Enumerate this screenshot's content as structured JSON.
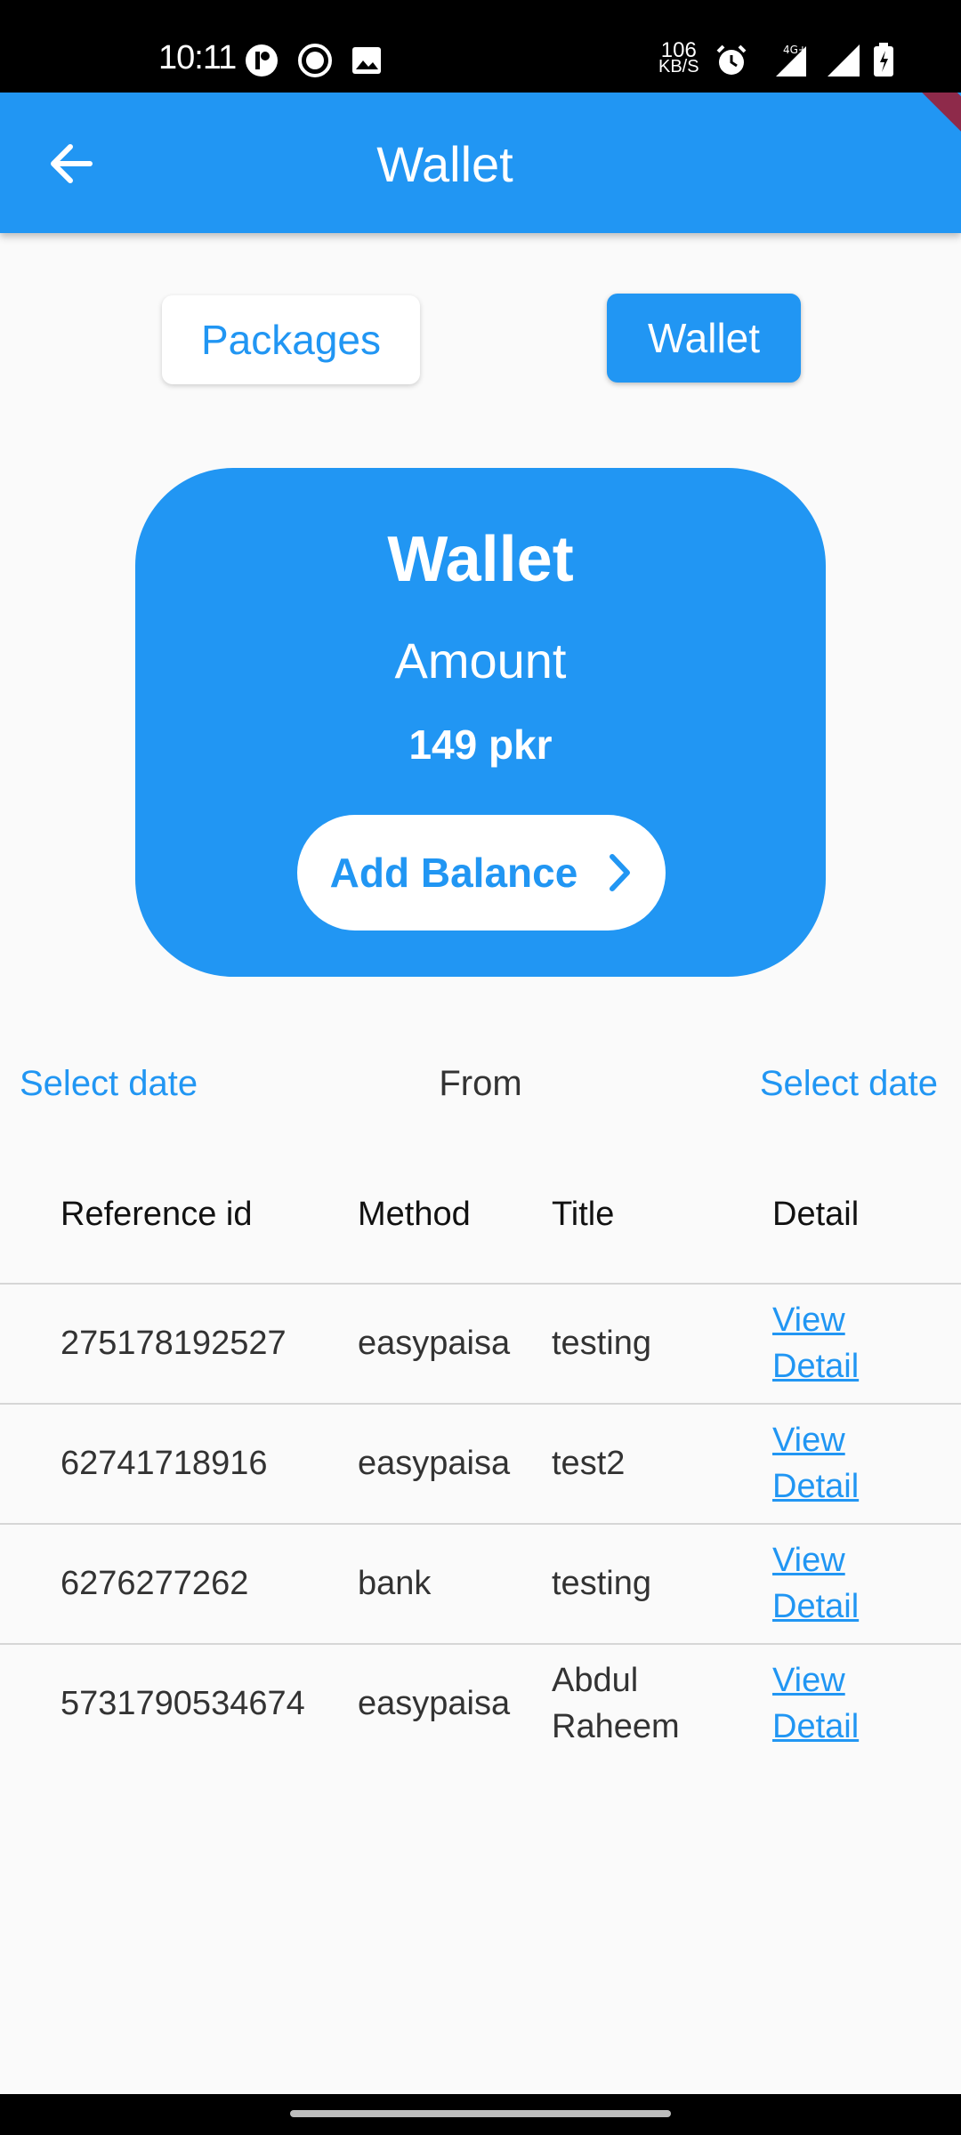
{
  "status_bar": {
    "time": "10:11",
    "speed_value": "106",
    "speed_unit": "KB/S",
    "network": "4G+",
    "icons": [
      "notification-icon",
      "record-icon",
      "image-icon",
      "alarm-icon",
      "signal-icon",
      "signal-icon",
      "battery-icon"
    ]
  },
  "app_bar": {
    "title": "Wallet",
    "back_icon": "arrow-back-icon"
  },
  "toggle": {
    "packages_label": "Packages",
    "wallet_label": "Wallet"
  },
  "wallet_card": {
    "title": "Wallet",
    "subtitle": "Amount",
    "amount": "149 pkr",
    "add_balance_label": "Add Balance"
  },
  "date_filter": {
    "start_label": "Select date",
    "from_label": "From",
    "end_label": "Select date"
  },
  "table": {
    "headers": [
      "Reference id",
      "Method",
      "Title",
      "Detail"
    ],
    "rows": [
      {
        "ref": "275178192527",
        "method": "easypaisa",
        "title": "testing",
        "detail_1": "View",
        "detail_2": "Detail"
      },
      {
        "ref": "62741718916",
        "method": "easypaisa",
        "title": "test2",
        "detail_1": "View",
        "detail_2": "Detail"
      },
      {
        "ref": "6276277262",
        "method": "bank",
        "title": "testing",
        "detail_1": "View",
        "detail_2": "Detail"
      },
      {
        "ref": "5731790534674",
        "method": "easypaisa",
        "title_1": "Abdul",
        "title_2": "Raheem",
        "detail_1": "View",
        "detail_2": "Detail"
      }
    ]
  },
  "colors": {
    "primary": "#2196f3",
    "background": "#fafafa"
  }
}
